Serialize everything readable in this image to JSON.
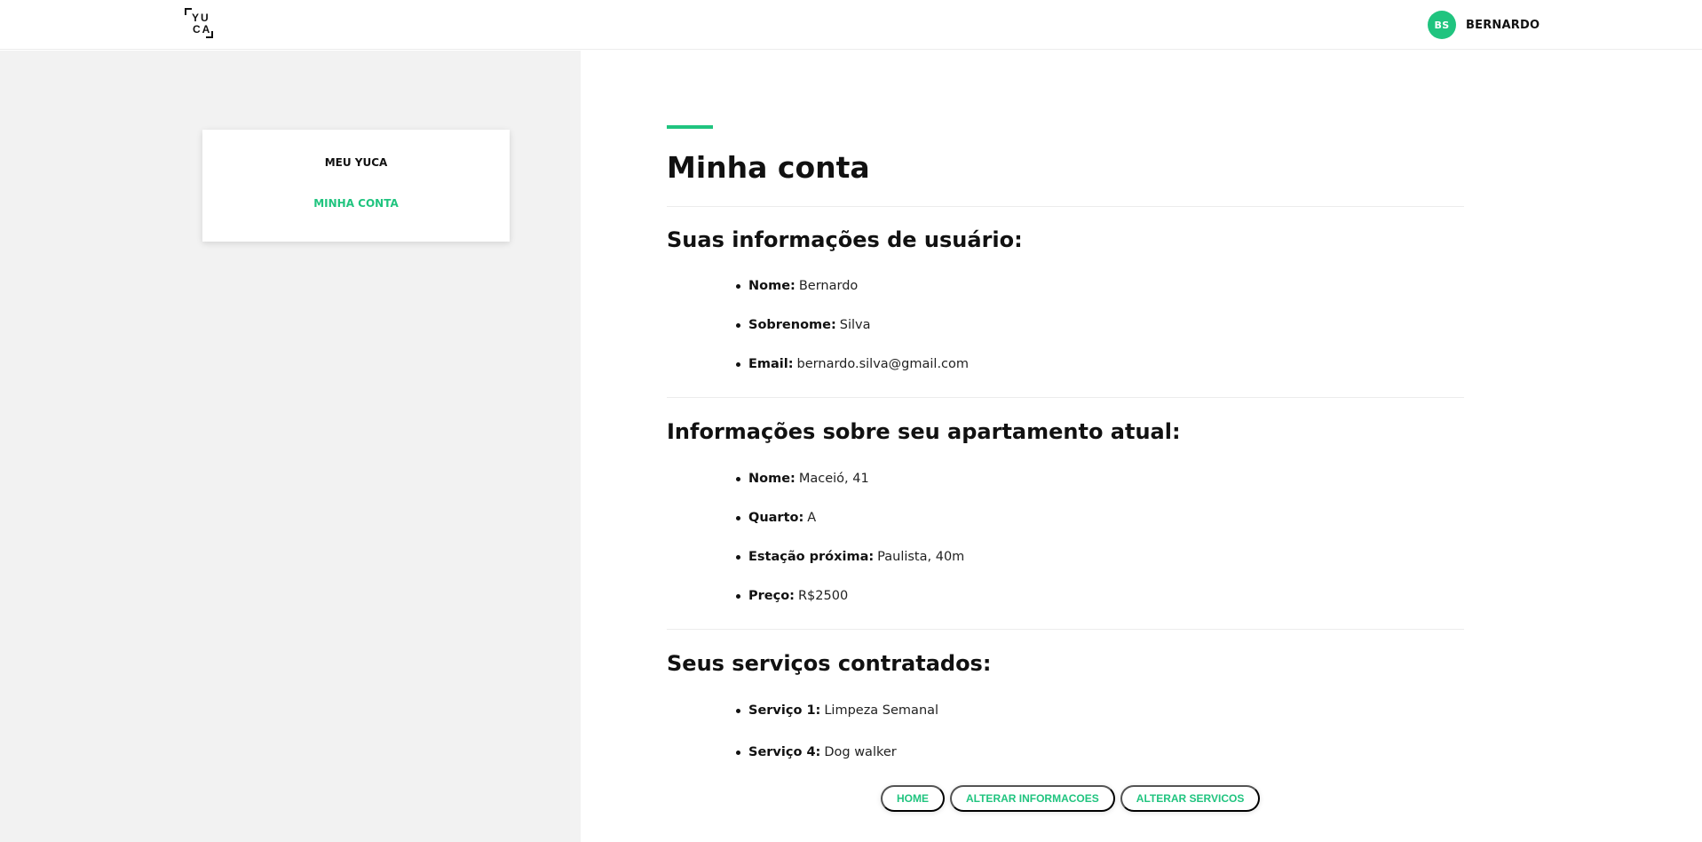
{
  "colors": {
    "accent": "#20c47f",
    "text": "#111111",
    "sidebar_bg": "#f2f2f2"
  },
  "header": {
    "logo": {
      "text_top": "YU",
      "text_bottom": "CA"
    },
    "user": {
      "initials": "BS",
      "name": "BERNARDO"
    }
  },
  "sidebar": {
    "title": "MEU YUCA",
    "link": "MINHA CONTA"
  },
  "main": {
    "title": "Minha conta",
    "user_section": {
      "heading": "Suas informações de usuário:",
      "items": [
        {
          "label": "Nome:",
          "value": "Bernardo"
        },
        {
          "label": "Sobrenome:",
          "value": "Silva"
        },
        {
          "label": "Email:",
          "value": "bernardo.silva@gmail.com"
        }
      ]
    },
    "apartment_section": {
      "heading": "Informações sobre seu apartamento atual:",
      "items": [
        {
          "label": "Nome:",
          "value": "Maceió, 41"
        },
        {
          "label": "Quarto:",
          "value": "A"
        },
        {
          "label": "Estação próxima:",
          "value": "Paulista, 40m"
        },
        {
          "label": "Preço:",
          "value": "R$2500"
        }
      ]
    },
    "services_section": {
      "heading": "Seus serviços contratados:",
      "items": [
        {
          "label": "Serviço 1:",
          "value": "Limpeza Semanal"
        },
        {
          "label": "Serviço 4:",
          "value": "Dog walker"
        }
      ]
    },
    "actions": [
      "HOME",
      "ALTERAR INFORMACOES",
      "ALTERAR SERVICOS"
    ]
  }
}
